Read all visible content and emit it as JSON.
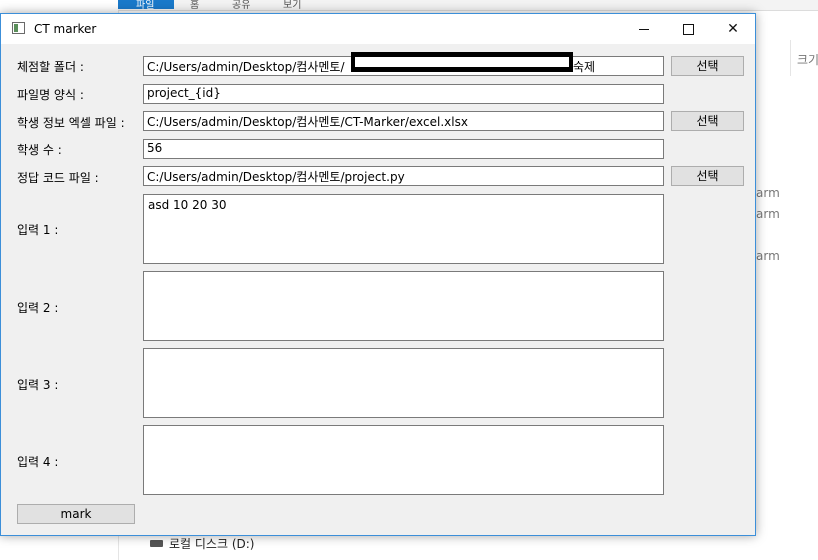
{
  "background": {
    "ribbon_labels": [
      "파일",
      "홈",
      "공유",
      "보기"
    ],
    "right_labels": [
      "크기",
      "arm",
      "arm",
      "arm"
    ],
    "drive_label": "로컬 디스크 (D:)"
  },
  "window": {
    "title": "CT marker",
    "controls": {
      "minimize": "",
      "maximize": "",
      "close": "✕"
    }
  },
  "form": {
    "folder": {
      "label": "체점할 폴더 :",
      "value": "C:/Users/admin/Desktop/컴사멘토/",
      "value_after_redaction": "숙제",
      "button": "선택"
    },
    "filename_format": {
      "label": "파일명 양식 :",
      "value": "project_{id}"
    },
    "student_excel": {
      "label": "학생 정보 엑셀 파일 :",
      "value": "C:/Users/admin/Desktop/컴사멘토/CT-Marker/excel.xlsx",
      "button": "선택"
    },
    "student_count": {
      "label": "학생 수 :",
      "value": "56"
    },
    "answer_code": {
      "label": "정답 코드 파일 :",
      "value": "C:/Users/admin/Desktop/컴사멘토/project.py",
      "button": "선택"
    },
    "inputs": [
      {
        "label": "입력 1 :",
        "value": "asd 10 20 30"
      },
      {
        "label": "입력 2 :",
        "value": ""
      },
      {
        "label": "입력 3 :",
        "value": ""
      },
      {
        "label": "입력 4 :",
        "value": ""
      }
    ],
    "mark_button": "mark"
  }
}
